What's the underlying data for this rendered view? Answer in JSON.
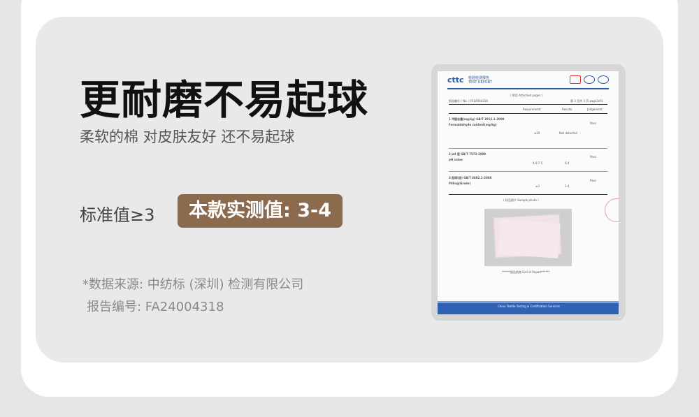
{
  "title": "更耐磨不易起球",
  "subtitle": "柔软的棉 对皮肤友好 还不易起球",
  "standard_label": "标准值≥3",
  "measured_badge": "本款实测值: 3-4",
  "source_line": "*数据来源: 中纺标 (深圳) 检测有限公司",
  "report_number_line": "报告编号: FA24004318",
  "colors": {
    "badge_bg": "#8b6a4e",
    "card_bg": "#e9e9e9",
    "title": "#111111"
  },
  "report": {
    "logo": "cttc",
    "logo_sub_cn": "检验检测报告",
    "logo_sub_en": "TEST REPORT",
    "attached_pages": "( 附页 Attached pages )",
    "report_no": "报告编号 ( No. ) FA24004318",
    "page": "第 3 页共 3 页 page3of3",
    "col_requirement": "Requirement",
    "col_results": "Results",
    "col_judgement": "Judgement",
    "item1": "1 甲醛含量(mg/kg) GB/T 2912.1-2009",
    "item1_en": "Formaldehyde content(mg/kg)",
    "item1_req": "≤20",
    "item1_result": "Not detected",
    "item1_judge": "Pass",
    "item2": "2 pH 值 GB/T 7573-2009",
    "item2_en": "pH value",
    "item2_req": "4.0-7.5",
    "item2_result": "6.4",
    "item2_judge": "Pass",
    "item3": "3 起球(级) GB/T 4802.1-2008",
    "item3_en": "Pilling(Grade)",
    "item3_req": "≥3",
    "item3_result": "3-4",
    "item3_judge": "Pass",
    "sample_photo": "( 样品照片 Sample photo )",
    "end_of_report": "******报告结束 End of Report******",
    "footer_org": "China Textile Testing & Certification Services"
  }
}
